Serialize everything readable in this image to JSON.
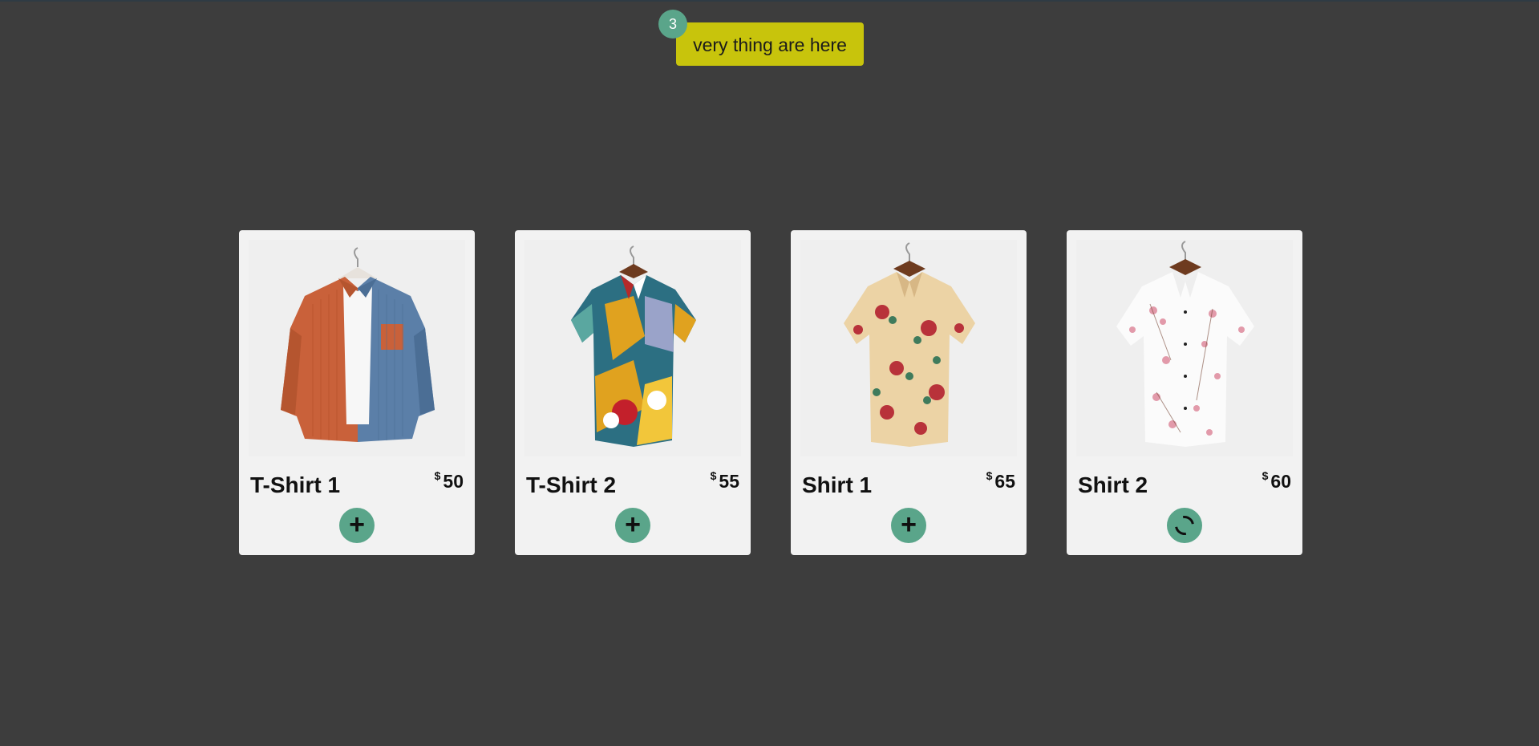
{
  "cart": {
    "count": "3",
    "label": "very thing are here",
    "accent": "#c8c40c",
    "badge_color": "#5aa58a"
  },
  "currency_symbol": "$",
  "products": [
    {
      "name": "T-Shirt 1",
      "price": "50",
      "image": "shirt-corduroy-orange-blue",
      "action_icon": "plus-icon",
      "state": "idle"
    },
    {
      "name": "T-Shirt 2",
      "price": "55",
      "image": "shirt-abstract-print",
      "action_icon": "plus-icon",
      "state": "idle"
    },
    {
      "name": "Shirt 1",
      "price": "65",
      "image": "shirt-floral-beige",
      "action_icon": "plus-icon",
      "state": "idle"
    },
    {
      "name": "Shirt 2",
      "price": "60",
      "image": "shirt-floral-white-pink",
      "action_icon": "spinner-icon",
      "state": "loading"
    }
  ]
}
